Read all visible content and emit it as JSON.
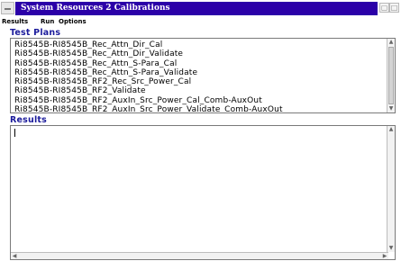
{
  "window": {
    "title": "System Resources 2 Calibrations",
    "restore_glyph": "▢",
    "close_glyph": "□"
  },
  "menubar": {
    "items": [
      "Results",
      "Run",
      "Options"
    ]
  },
  "test_plans": {
    "label": "Test Plans",
    "items": [
      "Ri8545B-RI8545B_Rec_Attn_Dir_Cal",
      "Ri8545B-RI8545B_Rec_Attn_Dir_Validate",
      "Ri8545B-RI8545B_Rec_Attn_S-Para_Cal",
      "Ri8545B-RI8545B_Rec_Attn_S-Para_Validate",
      "Ri8545B-RI8545B_RF2_Rec_Src_Power_Cal",
      "Ri8545B-RI8545B_RF2_Validate",
      "Ri8545B-RI8545B_RF2_AuxIn_Src_Power_Cal_Comb-AuxOut",
      "Ri8545B-RI8545B_RF2_AuxIn_Src_Power_Validate_Comb-AuxOut"
    ]
  },
  "results": {
    "label": "Results",
    "text": ""
  },
  "scroll_glyphs": {
    "up": "▲",
    "down": "▼",
    "left": "◀",
    "right": "▶"
  }
}
